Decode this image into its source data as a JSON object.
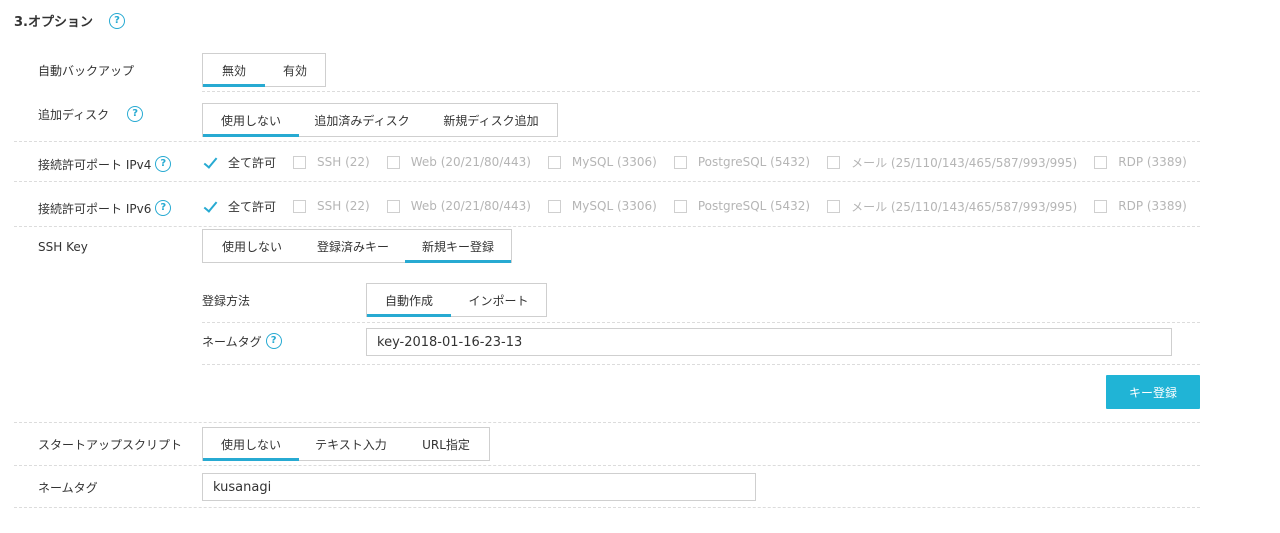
{
  "section": {
    "title": "3.オプション"
  },
  "auto_backup": {
    "label": "自動バックアップ",
    "options": [
      "無効",
      "有効"
    ],
    "selected": 0
  },
  "extra_disk": {
    "label": "追加ディスク",
    "options": [
      "使用しない",
      "追加済みディスク",
      "新規ディスク追加"
    ],
    "selected": 0
  },
  "ipv4": {
    "label": "接続許可ポート IPv4",
    "options": [
      "全て許可",
      "SSH (22)",
      "Web (20/21/80/443)",
      "MySQL (3306)",
      "PostgreSQL (5432)",
      "メール (25/110/143/465/587/993/995)",
      "RDP (3389)"
    ]
  },
  "ipv6": {
    "label": "接続許可ポート IPv6",
    "options": [
      "全て許可",
      "SSH (22)",
      "Web (20/21/80/443)",
      "MySQL (3306)",
      "PostgreSQL (5432)",
      "メール (25/110/143/465/587/993/995)",
      "RDP (3389)"
    ]
  },
  "ssh_key": {
    "label": "SSH Key",
    "options": [
      "使用しない",
      "登録済みキー",
      "新規キー登録"
    ],
    "selected": 2,
    "method": {
      "label": "登録方法",
      "options": [
        "自動作成",
        "インポート"
      ],
      "selected": 0
    },
    "name_tag": {
      "label": "ネームタグ",
      "value": "key-2018-01-16-23-13"
    },
    "register_button": "キー登録"
  },
  "startup_script": {
    "label": "スタートアップスクリプト",
    "options": [
      "使用しない",
      "テキスト入力",
      "URL指定"
    ],
    "selected": 0
  },
  "name_tag": {
    "label": "ネームタグ",
    "value": "kusanagi"
  },
  "colors": {
    "accent": "#27aad2",
    "button": "#20b4d6"
  }
}
